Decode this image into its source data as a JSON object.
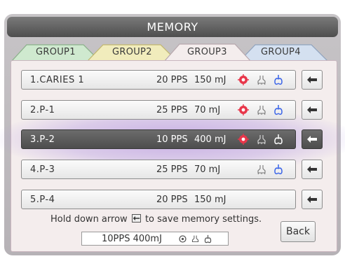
{
  "header": {
    "title": "MEMORY"
  },
  "tabs": [
    {
      "label": "GROUP1",
      "color": "#cfe9cf"
    },
    {
      "label": "GROUP2",
      "color": "#f1ecbc"
    },
    {
      "label": "GROUP3",
      "color": "#f4eded",
      "active": true
    },
    {
      "label": "GROUP4",
      "color": "#d4e0f0"
    }
  ],
  "rows": [
    {
      "name": "1.CARIES 1",
      "pps": "20 PPS",
      "mj": "150 mJ",
      "icons": [
        "red-target-icon",
        "spray-icon",
        "blue-lungs-icon"
      ],
      "selected": false
    },
    {
      "name": "2.P-1",
      "pps": "25 PPS",
      "mj": "70 mJ",
      "icons": [
        "red-target-icon",
        "spray-icon",
        "blue-lungs-icon"
      ],
      "selected": false
    },
    {
      "name": "3.P-2",
      "pps": "10 PPS",
      "mj": "400 mJ",
      "icons": [
        "red-target-icon",
        "spray-icon",
        "white-lungs-icon"
      ],
      "selected": true
    },
    {
      "name": "4.P-3",
      "pps": "25 PPS",
      "mj": "70 mJ",
      "icons": [
        "spray-icon",
        "blue-lungs-icon"
      ],
      "selected": false
    },
    {
      "name": "5.P-4",
      "pps": "20 PPS",
      "mj": "150 mJ",
      "icons": [],
      "selected": false
    }
  ],
  "hint": {
    "before": "Hold down arrow",
    "after": "to save memory settings."
  },
  "preview": {
    "text": "10PPS 400mJ"
  },
  "back_label": "Back",
  "colors": {
    "red": "#e8364a",
    "blue": "#3a64e8",
    "selected_row": "#555555"
  }
}
